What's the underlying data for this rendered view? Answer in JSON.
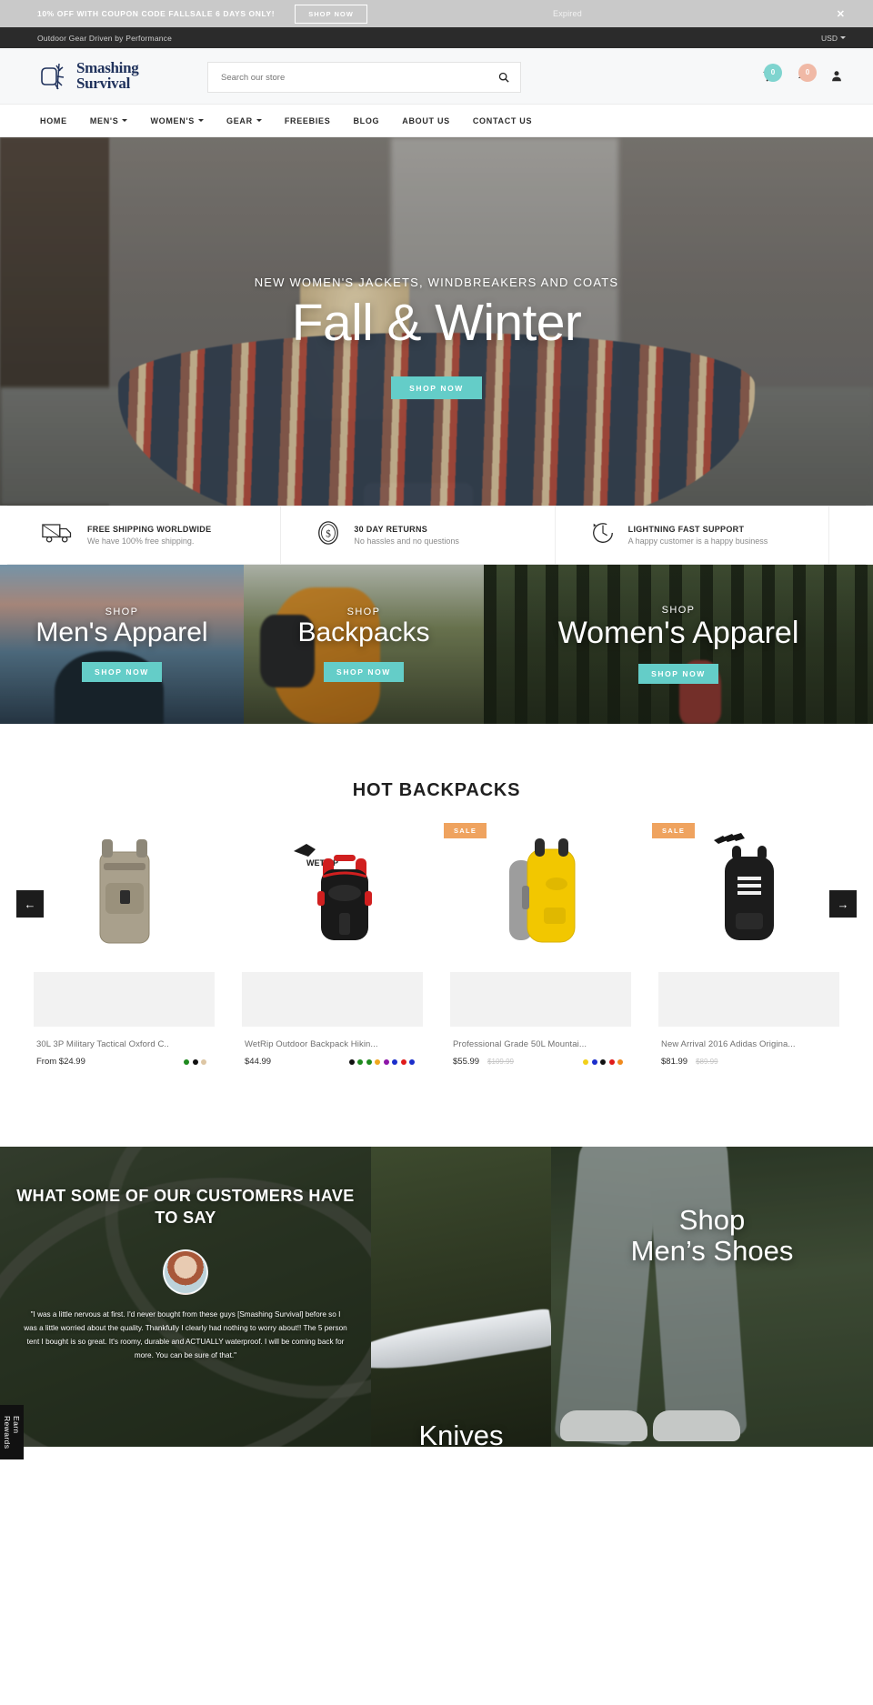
{
  "promo": {
    "text": "10% OFF WITH COUPON CODE FALLSALE 6 DAYS ONLY!",
    "button": "SHOP NOW",
    "status": "Expired",
    "close": "✕"
  },
  "topbar": {
    "tagline": "Outdoor Gear Driven by Performance",
    "currency": "USD"
  },
  "header": {
    "logo_line1": "Smashing",
    "logo_line2": "Survival",
    "search_placeholder": "Search our store",
    "search_value": "",
    "cart_count": "0",
    "wishlist_count": "0"
  },
  "nav": {
    "items": [
      {
        "label": "HOME",
        "caret": false
      },
      {
        "label": "MEN'S",
        "caret": true
      },
      {
        "label": "WOMEN'S",
        "caret": true
      },
      {
        "label": "GEAR",
        "caret": true
      },
      {
        "label": "FREEBIES",
        "caret": false
      },
      {
        "label": "BLOG",
        "caret": false
      },
      {
        "label": "ABOUT US",
        "caret": false
      },
      {
        "label": "CONTACT US",
        "caret": false
      }
    ]
  },
  "hero": {
    "kicker": "NEW WOMEN'S JACKETS, WINDBREAKERS AND COATS",
    "title": "Fall & Winter",
    "button": "SHOP NOW"
  },
  "trust": {
    "items": [
      {
        "icon": "truck-icon",
        "title": "FREE SHIPPING WORLDWIDE",
        "sub": "We have 100% free shipping."
      },
      {
        "icon": "dollar-coin-icon",
        "title": "30 DAY RETURNS",
        "sub": "No hassles and no questions"
      },
      {
        "icon": "clock-icon",
        "title": "LIGHTNING FAST SUPPORT",
        "sub": "A happy customer is a happy business"
      }
    ]
  },
  "categories": [
    {
      "shop": "SHOP",
      "title": "Men's Apparel",
      "button": "SHOP NOW"
    },
    {
      "shop": "SHOP",
      "title": "Backpacks",
      "button": "SHOP NOW"
    },
    {
      "shop": "SHOP",
      "title": "Women's Apparel",
      "button": "SHOP NOW"
    }
  ],
  "products_section": {
    "heading": "HOT BACKPACKS",
    "prev_arrow": "←",
    "next_arrow": "→",
    "items": [
      {
        "title": "30L 3P Military Tactical Oxford C..",
        "price": "From  $24.99",
        "price_old": "",
        "badge": "",
        "swatches": [
          "#1f8a1f",
          "#111111",
          "#ddc6a4"
        ]
      },
      {
        "title": "WetRip Outdoor Backpack Hikin...",
        "price": "$44.99",
        "price_old": "",
        "badge": "",
        "swatches": [
          "#111111",
          "#1f8a1f",
          "#1f8a1f",
          "#f0a81e",
          "#8d16a8",
          "#1b2ecb",
          "#e01b1b",
          "#1b2ecb"
        ]
      },
      {
        "title": "Professional Grade 50L Mountai...",
        "price": "$55.99",
        "price_old": "$109.99",
        "badge": "SALE",
        "swatches": [
          "#f2d01a",
          "#1b2ecb",
          "#111111",
          "#e01b1b",
          "#f08a1e"
        ]
      },
      {
        "title": "New Arrival 2016 Adidas Origina...",
        "price": "$81.99",
        "price_old": "$89.99",
        "badge": "SALE",
        "swatches": []
      }
    ]
  },
  "testimonial": {
    "title": "WHAT SOME OF OUR CUSTOMERS HAVE TO SAY",
    "quote": "\"I was a little nervous at first. I'd never bought from these guys [Smashing Survival] before so I was a little worried about the quality. Thankfully I clearly had nothing to worry about!! The 5 person tent I bought is so great. It's roomy, durable and ACTUALLY waterproof. I will be coming back for more. You can be sure of that.\""
  },
  "knives_panel": {
    "title": "Knives"
  },
  "shoes_panel": {
    "line1": "Shop",
    "line2": "Men’s Shoes"
  },
  "rewards_tab": {
    "label": "Earn Rewards"
  },
  "colors": {
    "accent_teal": "#64cdc8",
    "sale_orange": "#efa35f",
    "logo_navy": "#20325c",
    "dark_bar": "#2b2b2b",
    "promo_gray": "#c9c9c9"
  }
}
